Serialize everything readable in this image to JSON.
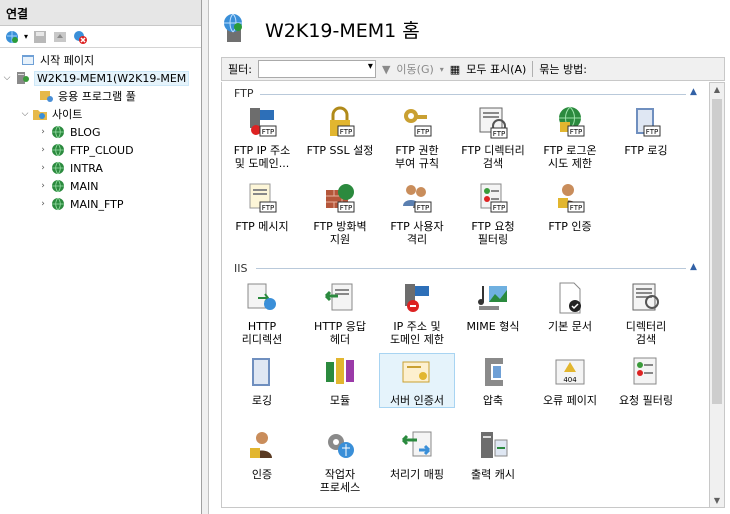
{
  "connections": {
    "header": "연결",
    "tree": [
      {
        "label": "시작 페이지"
      },
      {
        "label": "W2K19-MEM1(W2K19-MEM"
      },
      {
        "label": "응용 프로그램 풀"
      },
      {
        "label": "사이트"
      },
      {
        "label": "BLOG"
      },
      {
        "label": "FTP_CLOUD"
      },
      {
        "label": "INTRA"
      },
      {
        "label": "MAIN"
      },
      {
        "label": "MAIN_FTP"
      }
    ]
  },
  "main": {
    "title": "W2K19-MEM1 홈",
    "filter_label": "필터:",
    "go_label": "이동(G)",
    "show_all_label": "모두 표시(A)",
    "group_label": "묶는 방법:"
  },
  "sections": [
    {
      "name": "FTP",
      "features": [
        {
          "label1": "FTP IP 주소",
          "label2": "및 도메인..."
        },
        {
          "label1": "FTP SSL 설정",
          "label2": ""
        },
        {
          "label1": "FTP 권한",
          "label2": "부여 규칙"
        },
        {
          "label1": "FTP 디렉터리",
          "label2": "검색"
        },
        {
          "label1": "FTP 로그온",
          "label2": "시도 제한"
        },
        {
          "label1": "FTP 로깅",
          "label2": ""
        },
        {
          "label1": "FTP 메시지",
          "label2": ""
        },
        {
          "label1": "FTP 방화벽",
          "label2": "지원"
        },
        {
          "label1": "FTP 사용자",
          "label2": "격리"
        },
        {
          "label1": "FTP 요청",
          "label2": "필터링"
        },
        {
          "label1": "FTP 인증",
          "label2": ""
        }
      ]
    },
    {
      "name": "IIS",
      "features": [
        {
          "label1": "HTTP",
          "label2": "리디렉션"
        },
        {
          "label1": "HTTP 응답",
          "label2": "헤더"
        },
        {
          "label1": "IP 주소 및",
          "label2": "도메인 제한"
        },
        {
          "label1": "MIME 형식",
          "label2": ""
        },
        {
          "label1": "기본 문서",
          "label2": ""
        },
        {
          "label1": "디렉터리",
          "label2": "검색"
        },
        {
          "label1": "로깅",
          "label2": ""
        },
        {
          "label1": "모듈",
          "label2": ""
        },
        {
          "label1": "서버 인증서",
          "label2": ""
        },
        {
          "label1": "압축",
          "label2": ""
        },
        {
          "label1": "오류 페이지",
          "label2": ""
        },
        {
          "label1": "요청 필터링",
          "label2": ""
        },
        {
          "label1": "인증",
          "label2": ""
        },
        {
          "label1": "작업자",
          "label2": "프로세스"
        },
        {
          "label1": "처리기 매핑",
          "label2": ""
        },
        {
          "label1": "출력 캐시",
          "label2": ""
        }
      ]
    }
  ]
}
